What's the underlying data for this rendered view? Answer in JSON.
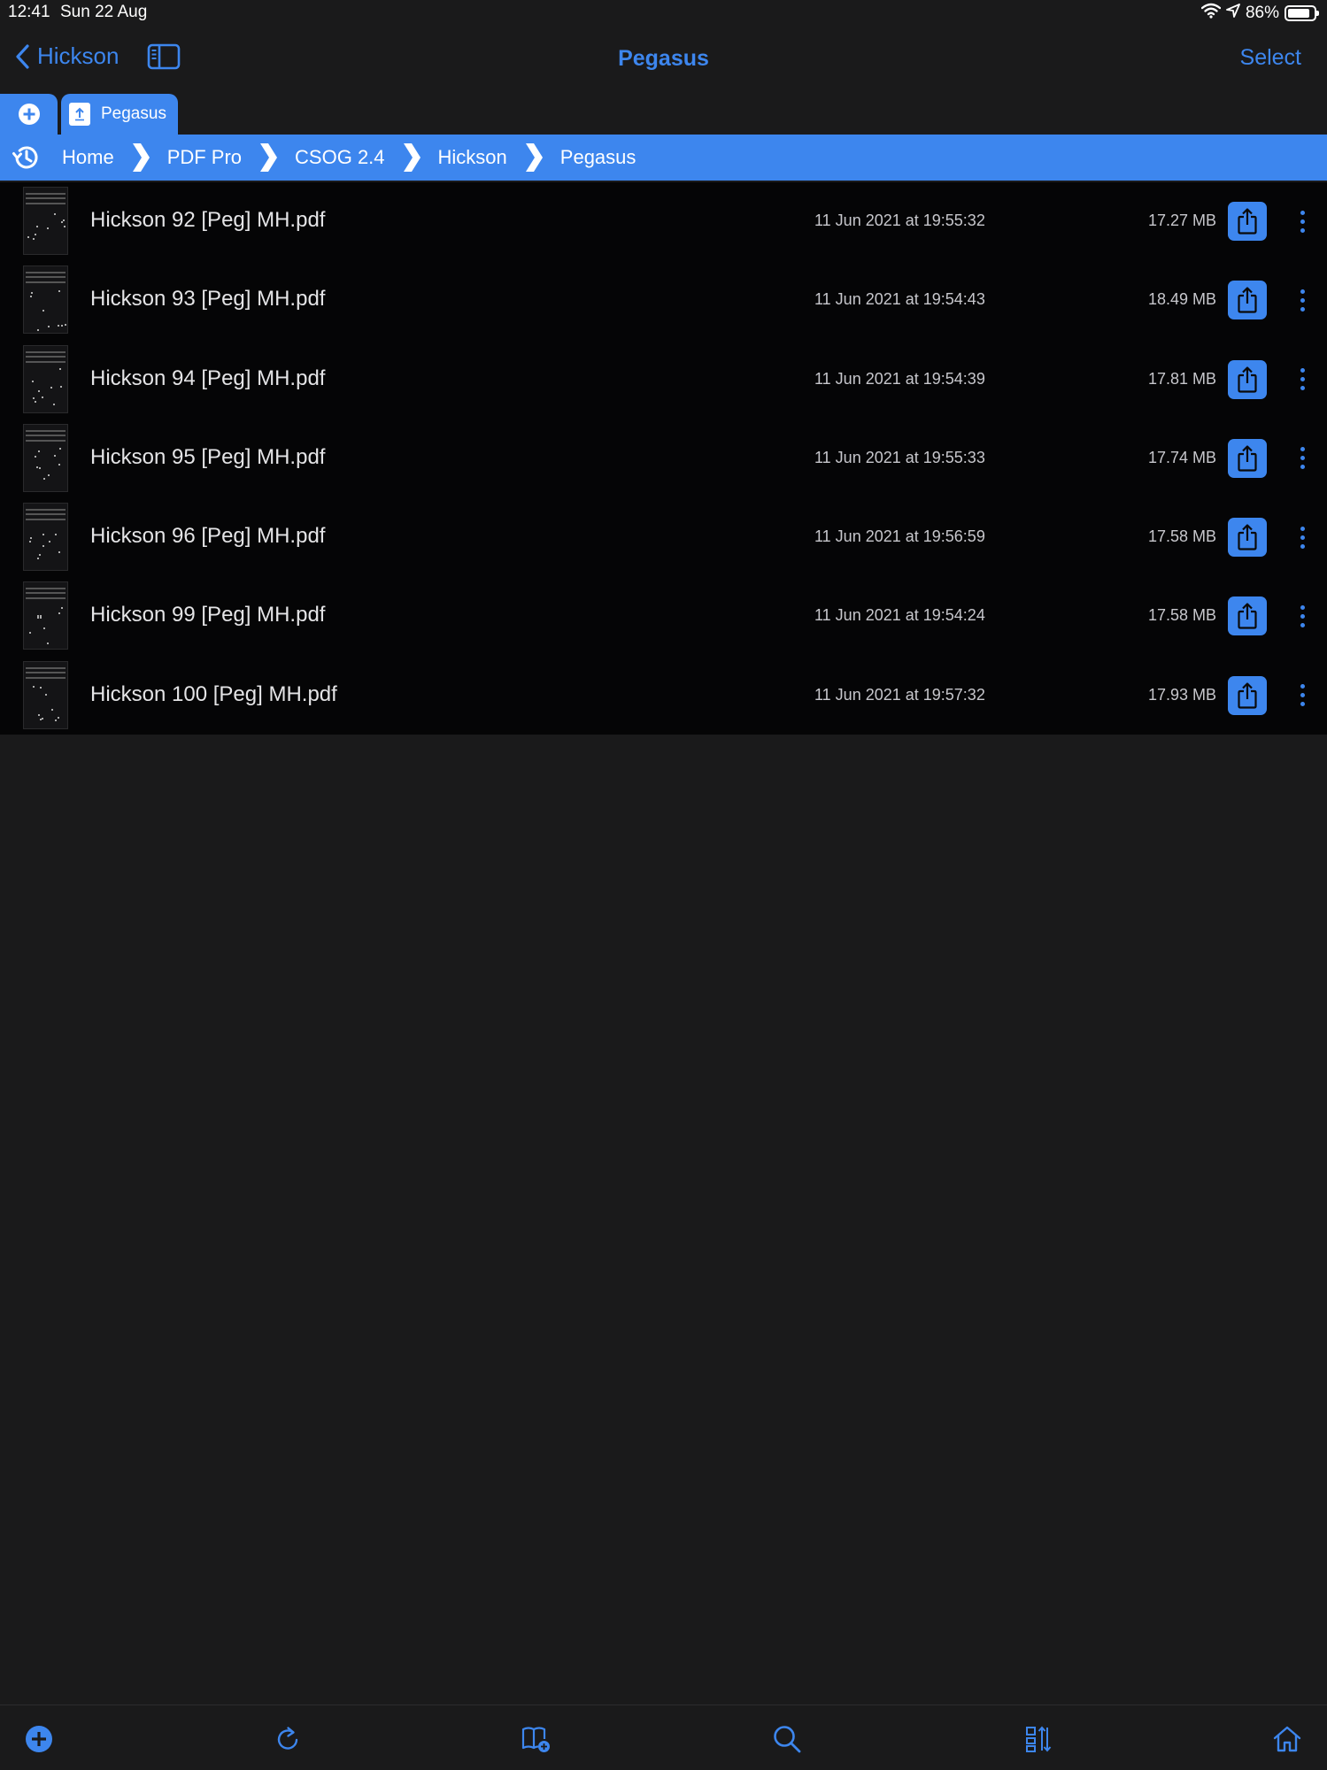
{
  "status_bar": {
    "time": "12:41",
    "date": "Sun 22 Aug",
    "battery_text": "86%",
    "battery_level": 0.86
  },
  "nav": {
    "back_label": "Hickson",
    "title": "Pegasus",
    "select_label": "Select"
  },
  "tabs": [
    {
      "label": "Pegasus",
      "icon": "doc-icon"
    }
  ],
  "breadcrumb": [
    "Home",
    "PDF Pro",
    "CSOG 2.4",
    "Hickson",
    "Pegasus"
  ],
  "files": [
    {
      "name": "Hickson 92 [Peg] MH.pdf",
      "date": "11 Jun 2021 at 19:55:32",
      "size": "17.27 MB"
    },
    {
      "name": "Hickson 93 [Peg] MH.pdf",
      "date": "11 Jun 2021 at 19:54:43",
      "size": "18.49 MB"
    },
    {
      "name": "Hickson 94 [Peg] MH.pdf",
      "date": "11 Jun 2021 at 19:54:39",
      "size": "17.81 MB"
    },
    {
      "name": "Hickson 95 [Peg] MH.pdf",
      "date": "11 Jun 2021 at 19:55:33",
      "size": "17.74 MB"
    },
    {
      "name": "Hickson 96 [Peg] MH.pdf",
      "date": "11 Jun 2021 at 19:56:59",
      "size": "17.58 MB"
    },
    {
      "name": "Hickson 99 [Peg] MH.pdf",
      "date": "11 Jun 2021 at 19:54:24",
      "size": "17.58 MB"
    },
    {
      "name": "Hickson 100 [Peg] MH.pdf",
      "date": "11 Jun 2021 at 19:57:32",
      "size": "17.93 MB"
    }
  ],
  "toolbar": [
    {
      "name": "add-icon"
    },
    {
      "name": "refresh-icon"
    },
    {
      "name": "bookmarks-add-icon"
    },
    {
      "name": "search-icon"
    },
    {
      "name": "sort-icon"
    },
    {
      "name": "home-icon"
    }
  ],
  "colors": {
    "accent": "#3d86ee",
    "background": "#1a1a1b",
    "list_background": "#050506",
    "text_primary": "#e4e4e6",
    "text_secondary": "#c7c7cc"
  }
}
